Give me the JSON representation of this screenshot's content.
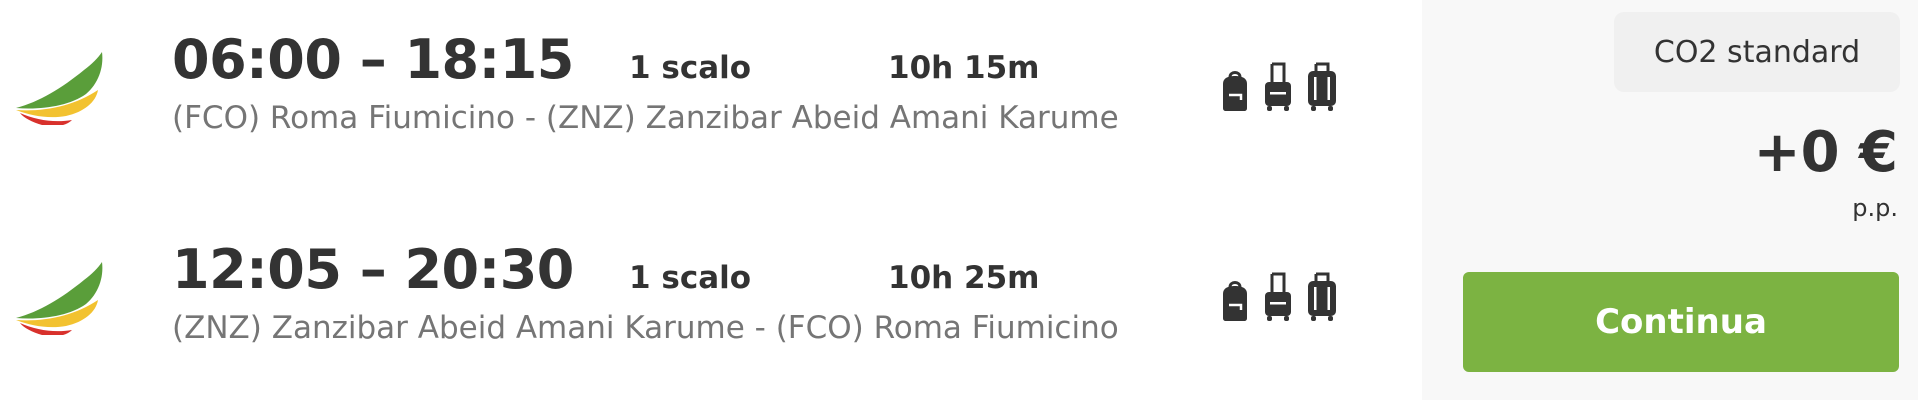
{
  "flights": [
    {
      "times": "06:00 – 18:15",
      "stops": "1 scalo",
      "duration": "10h 15m",
      "route": "(FCO) Roma Fiumicino - (ZNZ) Zanzibar Abeid Amani Karume",
      "airline_logo": "ethiopian-airlines-logo",
      "baggage_icons": [
        "backpack-icon",
        "carry-on-icon",
        "checked-bag-icon"
      ]
    },
    {
      "times": "12:05 – 20:30",
      "stops": "1 scalo",
      "duration": "10h 25m",
      "route": "(ZNZ) Zanzibar Abeid Amani Karume - (FCO) Roma Fiumicino",
      "airline_logo": "ethiopian-airlines-logo",
      "baggage_icons": [
        "backpack-icon",
        "carry-on-icon",
        "checked-bag-icon"
      ]
    }
  ],
  "sidebar": {
    "co2_label": "CO2 standard",
    "price": "+0 €",
    "price_unit": "p.p.",
    "continue_label": "Continua"
  },
  "colors": {
    "accent_green": "#7cb342",
    "logo_green": "#5a9e3a",
    "logo_yellow": "#f2c230",
    "logo_red": "#d8312c",
    "text_dark": "#333333",
    "text_muted": "#757575"
  }
}
